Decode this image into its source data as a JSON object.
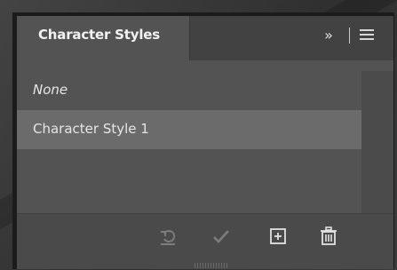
{
  "panel": {
    "title": "Character Styles",
    "collapse_glyph": "»"
  },
  "styles_list": [
    {
      "label": "None",
      "selected": false
    },
    {
      "label": "Character Style 1",
      "selected": true
    }
  ],
  "footer_icons": [
    "clear-override-icon",
    "redefine-style-checkmark-icon",
    "new-style-icon",
    "trash-icon"
  ],
  "colors": {
    "panel_bg": "#535353",
    "selected_row": "#6b6b6b",
    "text": "#e6e6e6"
  }
}
